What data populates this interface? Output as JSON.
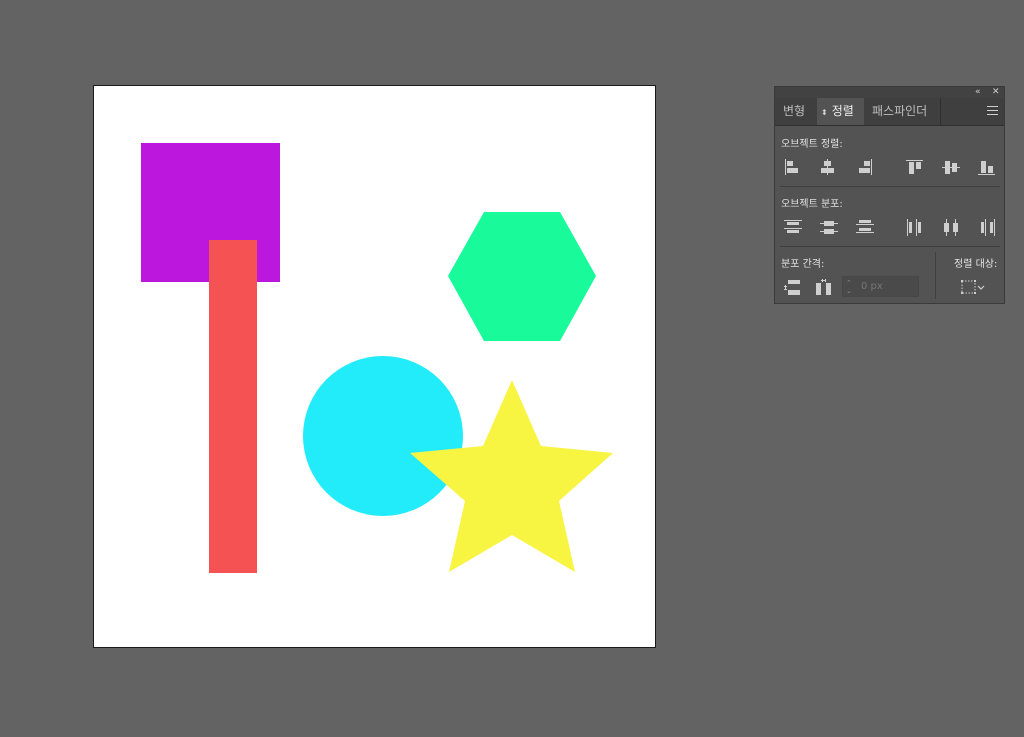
{
  "panel": {
    "collapse_glyph": "«",
    "close_glyph": "✕",
    "tabs": [
      {
        "label": "변형",
        "active": false
      },
      {
        "label": "정렬",
        "active": true
      },
      {
        "label": "패스파인더",
        "active": false
      }
    ],
    "active_tab_arrows": "⬍",
    "sections": {
      "align_objects": "오브젝트 정렬:",
      "distribute_objects": "오브젝트 분포:",
      "distribute_spacing": "분포 간격:",
      "align_to": "정렬 대상:"
    },
    "spacing_input": {
      "placeholder": "0 px"
    }
  },
  "colors": {
    "canvas_bg": "#636363",
    "artboard": "#ffffff",
    "square": "#bc17dd",
    "bar": "#f55353",
    "hexagon": "#19fb9b",
    "circle": "#22ecfa",
    "star": "#f7f442"
  },
  "shapes": [
    "square",
    "bar",
    "hexagon",
    "circle",
    "star"
  ]
}
